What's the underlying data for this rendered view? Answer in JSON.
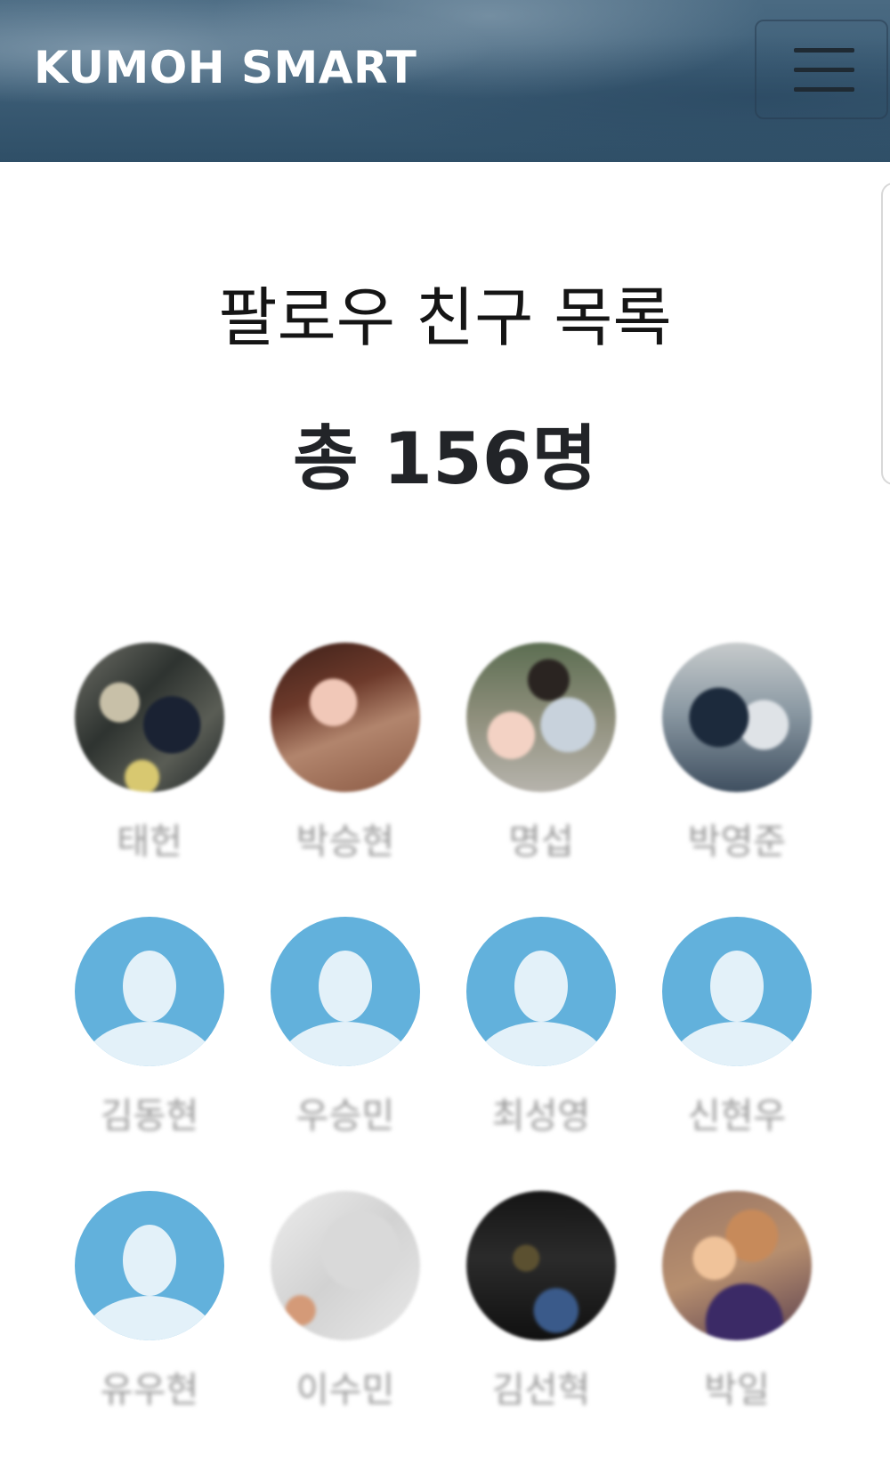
{
  "navbar": {
    "brand": "KUMOH SMART",
    "menu_icon": "hamburger-menu-icon"
  },
  "page": {
    "title": "팔로우 친구 목록",
    "count_text": "총 156명"
  },
  "friends": [
    {
      "name": "태헌",
      "avatar": "photo"
    },
    {
      "name": "박승현",
      "avatar": "photo"
    },
    {
      "name": "명섭",
      "avatar": "photo"
    },
    {
      "name": "박영준",
      "avatar": "photo"
    },
    {
      "name": "김동현",
      "avatar": "default-silhouette-icon"
    },
    {
      "name": "우승민",
      "avatar": "default-silhouette-icon"
    },
    {
      "name": "최성영",
      "avatar": "default-silhouette-icon"
    },
    {
      "name": "신현우",
      "avatar": "default-silhouette-icon"
    },
    {
      "name": "유우현",
      "avatar": "default-silhouette-icon"
    },
    {
      "name": "이수민",
      "avatar": "photo"
    },
    {
      "name": "김선혁",
      "avatar": "photo"
    },
    {
      "name": "박일",
      "avatar": "photo"
    }
  ]
}
